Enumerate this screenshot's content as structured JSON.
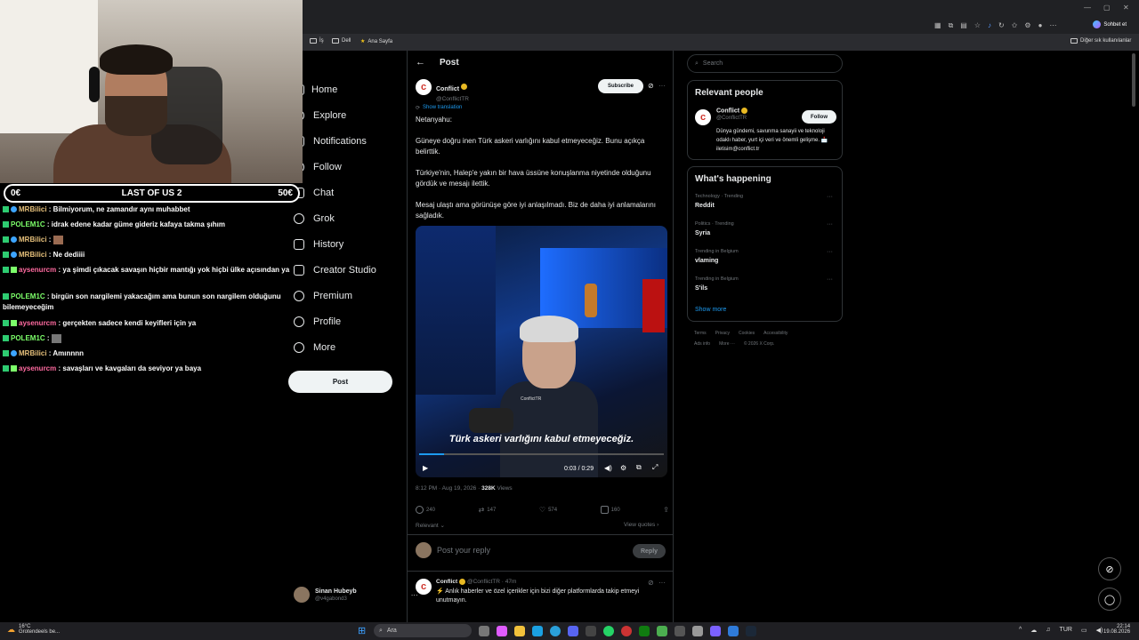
{
  "browser": {
    "bookmarks": [
      "İş",
      "Dell",
      "Ana Sayfa"
    ],
    "other_bookmarks": "Diğer sık kullanılanlar",
    "chat_label": "Sohbet et"
  },
  "stream": {
    "game_bar": {
      "left": "0€",
      "title": "LAST OF US 2",
      "right": "50€"
    },
    "chat": [
      {
        "user": "MRBilici",
        "text": ": Bilmiyorum, ne zamandır aynı muhabbet"
      },
      {
        "user": "POLEM1C",
        "text": ": idrak edene kadar güme gideriz kafaya takma şıhım"
      },
      {
        "user": "MRBilici",
        "text": ":"
      },
      {
        "user": "MRBilici",
        "text": ": Ne dediiii"
      },
      {
        "user": "aysenurcm",
        "text": ": ya şimdi çıkacak savaşın hiçbir mantığı yok hiçbi ülke açısından ya"
      },
      {
        "user": "POLEM1C",
        "text": ": birgün son nargilemi yakacağım ama bunun son nargilem olduğunu bilemeyeceğim"
      },
      {
        "user": "aysenurcm",
        "text": ": gerçekten sadece kendi keyifleri için ya"
      },
      {
        "user": "POLEM1C",
        "text": ":"
      },
      {
        "user": "MRBilici",
        "text": ": Amınnnn"
      },
      {
        "user": "aysenurcm",
        "text": ": savaşları ve kavgaları da seviyor ya baya"
      }
    ]
  },
  "nav": {
    "items": [
      "Home",
      "Explore",
      "Notifications",
      "Follow",
      "Chat",
      "Grok",
      "History",
      "Creator Studio",
      "Premium",
      "Profile",
      "More"
    ],
    "post_button": "Post",
    "account_name": "Sinan Hubeyb",
    "account_handle": "@v4gabond3"
  },
  "post": {
    "header_title": "Post",
    "author_name": "Conflict",
    "author_handle": "@ConflictTR",
    "subscribe_label": "Subscribe",
    "show_translation": "Show translation",
    "paragraphs": [
      "Netanyahu:",
      "Güneye doğru inen Türk askeri varlığını kabul etmeyeceğiz. Bunu açıkça belirttik.",
      "Türkiye'nin, Halep'e yakın bir hava üssüne konuşlanma niyetinde olduğunu gördük ve mesajı ilettik.",
      "Mesaj ulaştı ama görünüşe göre iyi anlaşılmadı. Biz de daha iyi anlamalarını sağladık."
    ],
    "video": {
      "subtitle": "Türk askeri varlığını kabul etmeyeceğiz.",
      "time": "0:03 / 0:29",
      "progress": 0.1,
      "watermark": "ConflictTR"
    },
    "meta_time": "8:12 PM · Aug 19, 2026 ·",
    "views_count": "328K",
    "views_label": "Views",
    "stats": {
      "replies": "240",
      "reposts": "147",
      "likes": "574",
      "bookmarks": "160"
    },
    "relevant_label": "Relevant",
    "view_quotes": "View quotes",
    "reply_placeholder": "Post your reply",
    "reply_button": "Reply"
  },
  "reply": {
    "author_name": "Conflict",
    "author_handle": "@ConflictTR · 47m",
    "text": "⚡ Anlık haberler ve özel içerikler için bizi diğer platformlarda takip etmeyi unutmayın."
  },
  "sidebar": {
    "search_placeholder": "Search",
    "relevant_title": "Relevant people",
    "person_name": "Conflict",
    "person_handle": "@ConflictTR",
    "follow_label": "Follow",
    "person_bio": "Dünya gündemi, savunma sanayii ve teknoloji odaklı haber, yurt içi veri ve önemli gelişme. 📩 iletisim@conflict.tr",
    "happening_title": "What's happening",
    "trends": [
      {
        "context": "Technology · Trending",
        "name": "Reddit"
      },
      {
        "context": "Politics · Trending",
        "name": "Syria"
      },
      {
        "context": "Trending in Belgium",
        "name": "vlaming"
      },
      {
        "context": "Trending in Belgium",
        "name": "S'ils"
      }
    ],
    "show_more": "Show more",
    "footer_row1": [
      "Terms",
      "Privacy",
      "Cookies",
      "Accessibility"
    ],
    "footer_row2": [
      "Ads info",
      "More ···",
      "© 2026 X Corp."
    ]
  },
  "taskbar": {
    "weather_temp": "16°C",
    "weather_desc": "Grotendeels be...",
    "search_label": "Ara",
    "lang": "TUR",
    "time": "22:14",
    "date": "19.08.2026"
  },
  "colors": {
    "accent": "#1d9bf0",
    "background": "#000000",
    "verified": "#e8b923"
  }
}
